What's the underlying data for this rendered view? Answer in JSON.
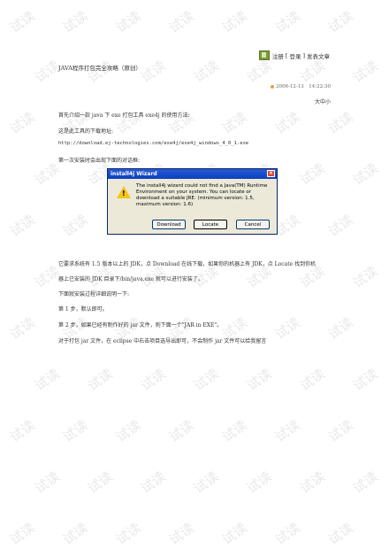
{
  "watermark": "试读",
  "nav": {
    "register": "注册",
    "sep1": "[",
    "login": "登录",
    "sep2": "]",
    "post": "发表文章"
  },
  "article": {
    "title": "JAVA程序打包完全攻略（原创）",
    "date": "2006-12-13　14:22:30",
    "font_size_control": "大中小",
    "para1": "首先介绍一款 java 下 exe 打包工具 exe4j 的使用方法:",
    "para2": "这是此工具的下载地址:",
    "url": "http://download.ej-technologies.com/exe4j/exe4j_windows_4_0_1.exe",
    "para3": "第一次安装时会出现下面的对话框:",
    "para4": "它要求系统有 1.5 版本以上的 JDK，点 Download 在线下载，如果你的机器上有 JDK，点 Locate 找到你机",
    "para5": "器上已安装的 JDK 目录下/bin/java.exe 就可以进行安装了。",
    "para6": "下面就安装过程详细说明一下:",
    "step1": "第 1 步，默认即可。",
    "step2": "第 2 步，如果已经有制作好的 jar 文件，则下面一个\"JAR in EXE\"。",
    "para7": "对于打包 jar 文件，在 eclipse 中右击项目选导出即可，不会制作 jar 文件可以给我留言"
  },
  "dialog": {
    "title": "install4j Wizard",
    "close": "×",
    "warn_mark": "!",
    "message": "The install4j wizard could not find a Java(TM) Runtime Environment on your system. You can locate or download a suitable JRE. (minimum version: 1.5, maximum version: 1.6)",
    "download": "Download",
    "locate": "Locate",
    "cancel": "Cancel"
  }
}
